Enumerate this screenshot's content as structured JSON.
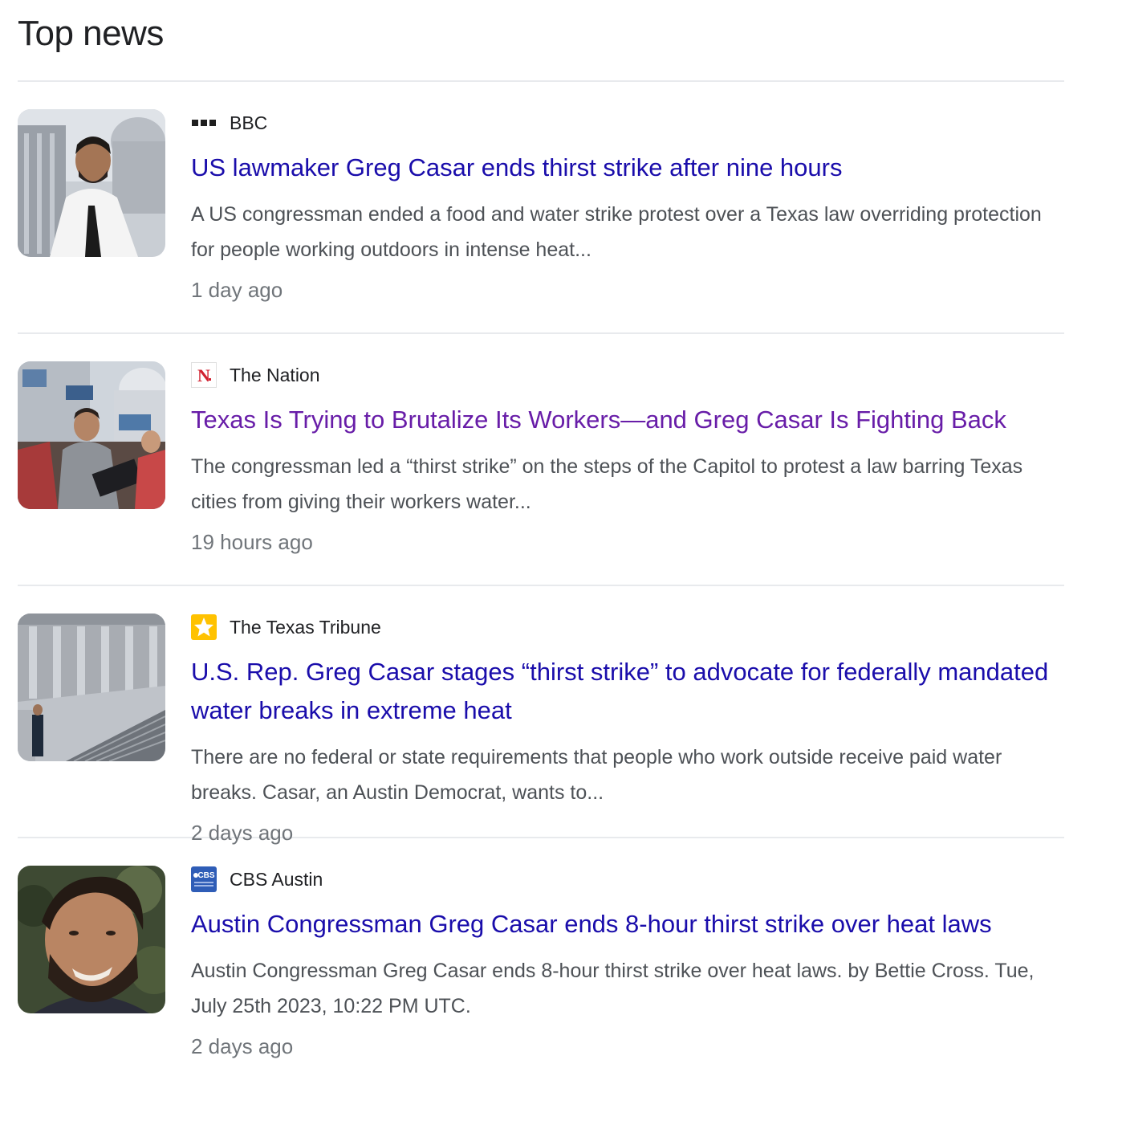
{
  "section": {
    "title": "Top news"
  },
  "colors": {
    "link": "#1a0dab",
    "visited_link": "#681da8",
    "snippet": "#4d5156",
    "meta": "#70757a"
  },
  "stories": [
    {
      "source": "BBC",
      "favicon": "bbc-logo-icon",
      "headline": "US lawmaker Greg Casar ends thirst strike after nine hours",
      "snippet": "A US congressman ended a food and water strike protest over a Texas law overriding protection for people working outdoors in intense heat...",
      "time": "1 day ago",
      "visited": false
    },
    {
      "source": "The Nation",
      "favicon": "the-nation-logo-icon",
      "headline": "Texas Is Trying to Brutalize Its Workers—and Greg Casar Is Fighting Back",
      "snippet": "The congressman led a “thirst strike” on the steps of the Capitol to protest a law barring Texas cities from giving their workers water...",
      "time": "19 hours ago",
      "visited": true
    },
    {
      "source": "The Texas Tribune",
      "favicon": "texas-tribune-star-icon",
      "headline": "U.S. Rep. Greg Casar stages “thirst strike” to advocate for federally mandated water breaks in extreme heat",
      "snippet": "There are no federal or state requirements that people who work outside receive paid water breaks. Casar, an Austin Democrat, wants to...",
      "time": "2 days ago",
      "visited": false
    },
    {
      "source": "CBS Austin",
      "favicon": "cbs-austin-logo-icon",
      "headline": "Austin Congressman Greg Casar ends 8-hour thirst strike over heat laws",
      "snippet": "Austin Congressman Greg Casar ends 8-hour thirst strike over heat laws. by Bettie Cross. Tue, July 25th 2023, 10:22 PM UTC.",
      "time": "2 days ago",
      "visited": false
    }
  ]
}
